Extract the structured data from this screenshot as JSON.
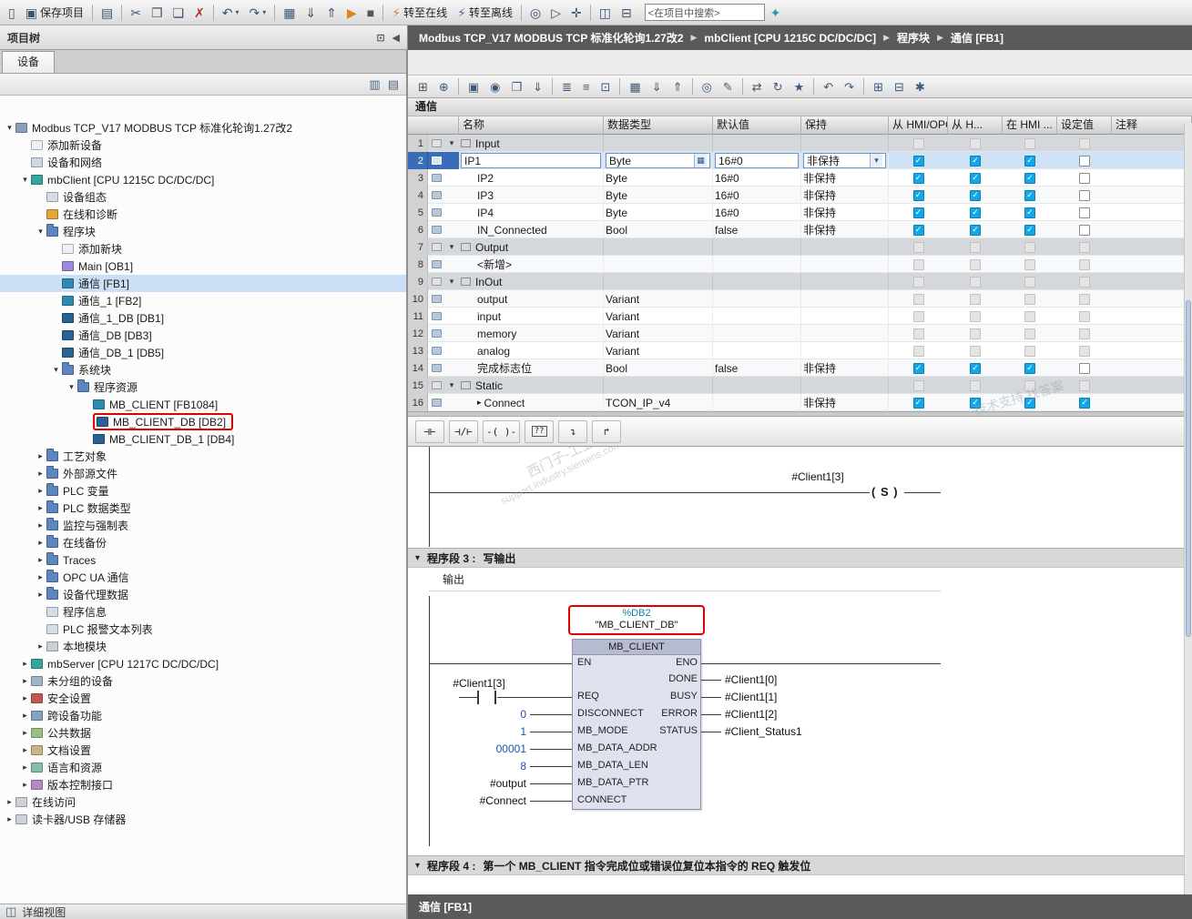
{
  "colors": {
    "check_on": "#14a7e8",
    "selection_blue": "#3a6db8",
    "highlight_red": "#e00000",
    "breadcrumb_bg": "#5a5a5a"
  },
  "breadcrumb": {
    "items": [
      "Modbus TCP_V17 MODBUS TCP 标准化轮询1.27改2",
      "mbClient [CPU 1215C DC/DC/DC]",
      "程序块",
      "通信 [FB1]"
    ]
  },
  "top_toolbar": {
    "items": [
      {
        "name": "new-project",
        "glyph": "▯"
      },
      {
        "name": "save-project",
        "glyph": "▣",
        "label": "保存项目"
      },
      {
        "sep": true
      },
      {
        "name": "print",
        "glyph": "▤"
      },
      {
        "sep": true
      },
      {
        "name": "cut",
        "glyph": "✂"
      },
      {
        "name": "copy",
        "glyph": "❐"
      },
      {
        "name": "paste",
        "glyph": "❏"
      },
      {
        "name": "delete",
        "glyph": "✗"
      },
      {
        "sep": true
      },
      {
        "name": "undo",
        "glyph": "↶",
        "dd": true
      },
      {
        "name": "redo",
        "glyph": "↷",
        "dd": true
      },
      {
        "sep": true
      },
      {
        "name": "compile",
        "glyph": "▦"
      },
      {
        "name": "download-to-device",
        "glyph": "⇓"
      },
      {
        "name": "upload-from-device",
        "glyph": "⇑"
      },
      {
        "name": "start-cpu",
        "glyph": "▶"
      },
      {
        "name": "stop-cpu",
        "glyph": "■"
      },
      {
        "sep": true
      },
      {
        "name": "go-online",
        "glyph": "⚡",
        "label": "转至在线"
      },
      {
        "name": "go-offline",
        "glyph": "⚡",
        "label": "转至离线"
      },
      {
        "sep": true
      },
      {
        "name": "accessible-devices",
        "glyph": "◎"
      },
      {
        "name": "start-simulation",
        "glyph": "▷"
      },
      {
        "name": "cross-reference",
        "glyph": "✛"
      },
      {
        "sep": true
      },
      {
        "name": "split-editor-horizontal",
        "glyph": "◫"
      },
      {
        "name": "split-editor-vertical",
        "glyph": "⊟"
      },
      {
        "search": true,
        "name": "project-search",
        "value": "<在项目中搜索>"
      },
      {
        "name": "tia-portal",
        "glyph": "✦"
      }
    ]
  },
  "sidebar": {
    "title": "项目树",
    "tab_devices": "设备",
    "detail_view": "详细视图",
    "tree": [
      {
        "indent": 0,
        "exp": "v",
        "icon": "project",
        "label": "Modbus TCP_V17 MODBUS TCP 标准化轮询1.27改2"
      },
      {
        "indent": 1,
        "icon": "add-device",
        "label": "添加新设备"
      },
      {
        "indent": 1,
        "icon": "devices-networks",
        "label": "设备和网络"
      },
      {
        "indent": 1,
        "exp": "v",
        "icon": "plc",
        "label": "mbClient [CPU 1215C DC/DC/DC]"
      },
      {
        "indent": 2,
        "icon": "device-config",
        "label": "设备组态"
      },
      {
        "indent": 2,
        "icon": "online-diagnostics",
        "label": "在线和诊断"
      },
      {
        "indent": 2,
        "exp": "v",
        "icon": "folder-program",
        "label": "程序块"
      },
      {
        "indent": 3,
        "icon": "add-block",
        "label": "添加新块"
      },
      {
        "indent": 3,
        "icon": "block-ob",
        "label": "Main [OB1]"
      },
      {
        "indent": 3,
        "icon": "block-fb",
        "label": "通信 [FB1]",
        "sel": true
      },
      {
        "indent": 3,
        "icon": "block-fb",
        "label": "通信_1 [FB2]"
      },
      {
        "indent": 3,
        "icon": "block-db",
        "label": "通信_1_DB [DB1]"
      },
      {
        "indent": 3,
        "icon": "block-db",
        "label": "通信_DB [DB3]"
      },
      {
        "indent": 3,
        "icon": "block-db",
        "label": "通信_DB_1 [DB5]"
      },
      {
        "indent": 3,
        "exp": "v",
        "icon": "folder-system",
        "label": "系统块"
      },
      {
        "indent": 4,
        "exp": "v",
        "icon": "folder-resources",
        "label": "程序资源"
      },
      {
        "indent": 5,
        "icon": "block-fb",
        "label": "MB_CLIENT [FB1084]"
      },
      {
        "indent": 5,
        "icon": "block-db",
        "label": "MB_CLIENT_DB [DB2]",
        "red": true
      },
      {
        "indent": 5,
        "icon": "block-db",
        "label": "MB_CLIENT_DB_1 [DB4]"
      },
      {
        "indent": 2,
        "exp": ">",
        "icon": "folder-tech",
        "label": "工艺对象"
      },
      {
        "indent": 2,
        "exp": ">",
        "icon": "folder-sources",
        "label": "外部源文件"
      },
      {
        "indent": 2,
        "exp": ">",
        "icon": "folder-tags",
        "label": "PLC 变量"
      },
      {
        "indent": 2,
        "exp": ">",
        "icon": "folder-datatypes",
        "label": "PLC 数据类型"
      },
      {
        "indent": 2,
        "exp": ">",
        "icon": "folder-watch",
        "label": "监控与强制表"
      },
      {
        "indent": 2,
        "exp": ">",
        "icon": "folder-backup",
        "label": "在线备份"
      },
      {
        "indent": 2,
        "exp": ">",
        "icon": "folder-traces",
        "label": "Traces"
      },
      {
        "indent": 2,
        "exp": ">",
        "icon": "folder-opcua",
        "label": "OPC UA 通信"
      },
      {
        "indent": 2,
        "exp": ">",
        "icon": "folder-proxy",
        "label": "设备代理数据"
      },
      {
        "indent": 2,
        "icon": "program-info",
        "label": "程序信息"
      },
      {
        "indent": 2,
        "icon": "alarm-texts",
        "label": "PLC 报警文本列表"
      },
      {
        "indent": 2,
        "exp": ">",
        "icon": "local-modules",
        "label": "本地模块"
      },
      {
        "indent": 1,
        "exp": ">",
        "icon": "plc",
        "label": "mbServer [CPU 1217C DC/DC/DC]"
      },
      {
        "indent": 1,
        "exp": ">",
        "icon": "ungrouped-devices",
        "label": "未分组的设备"
      },
      {
        "indent": 1,
        "exp": ">",
        "icon": "security-settings",
        "label": "安全设置"
      },
      {
        "indent": 1,
        "exp": ">",
        "icon": "cross-device",
        "label": "跨设备功能"
      },
      {
        "indent": 1,
        "exp": ">",
        "icon": "common-data",
        "label": "公共数据"
      },
      {
        "indent": 1,
        "exp": ">",
        "icon": "doc-settings",
        "label": "文档设置"
      },
      {
        "indent": 1,
        "exp": ">",
        "icon": "languages",
        "label": "语言和资源"
      },
      {
        "indent": 1,
        "exp": ">",
        "icon": "version-control",
        "label": "版本控制接口"
      },
      {
        "indent": 0,
        "exp": ">",
        "icon": "online-access",
        "label": "在线访问"
      },
      {
        "indent": 0,
        "exp": ">",
        "icon": "card-reader",
        "label": "读卡器/USB 存储器"
      }
    ]
  },
  "editor": {
    "block_title": "通信",
    "bottom_tab": "通信 [FB1]",
    "toolbar": {
      "items": [
        {
          "name": "insert-row",
          "glyph": "⊞"
        },
        {
          "name": "add-row",
          "glyph": "⊕"
        },
        {
          "sep": true
        },
        {
          "name": "keep-actual-values",
          "glyph": "▣"
        },
        {
          "name": "snapshot-actual-values",
          "glyph": "◉"
        },
        {
          "name": "copy-snapshot-to-start",
          "glyph": "❐"
        },
        {
          "name": "load-start-values",
          "glyph": "⇓"
        },
        {
          "sep": true
        },
        {
          "name": "sort-ascending",
          "glyph": "≣"
        },
        {
          "name": "sort-descending",
          "glyph": "≡"
        },
        {
          "name": "toggle-comment",
          "glyph": "⊡"
        },
        {
          "sep": true
        },
        {
          "name": "compile-block",
          "glyph": "▦"
        },
        {
          "name": "download-block",
          "glyph": "⇓"
        },
        {
          "name": "upload-block",
          "glyph": "⇑"
        },
        {
          "sep": true
        },
        {
          "name": "monitor-on-off",
          "glyph": "◎"
        },
        {
          "name": "modify-values",
          "glyph": "✎"
        },
        {
          "sep": true
        },
        {
          "name": "absolute-operands",
          "glyph": "⇄"
        },
        {
          "name": "update-block-call",
          "glyph": "↻"
        },
        {
          "name": "show-favorites",
          "glyph": "★"
        },
        {
          "sep": true
        },
        {
          "name": "go-to-previous",
          "glyph": "↶"
        },
        {
          "name": "go-to-next",
          "glyph": "↷"
        },
        {
          "sep": true
        },
        {
          "name": "insert-network",
          "glyph": "⊞"
        },
        {
          "name": "delete-network",
          "glyph": "⊟"
        },
        {
          "name": "settings",
          "glyph": "✱"
        }
      ]
    },
    "table": {
      "columns": [
        "",
        "名称",
        "数据类型",
        "默认值",
        "保持",
        "从 HMI/OPC..",
        "从 H...",
        "在 HMI ...",
        "设定值",
        "注释"
      ],
      "rows": [
        {
          "n": 1,
          "kind": "section",
          "name": "Input",
          "type": "",
          "def": "",
          "retain": ""
        },
        {
          "n": 2,
          "kind": "var",
          "name": "IP1",
          "type": "Byte",
          "def": "16#0",
          "retain": "非保持",
          "c": [
            1,
            1,
            1,
            0
          ],
          "selected": true
        },
        {
          "n": 3,
          "kind": "var",
          "name": "IP2",
          "type": "Byte",
          "def": "16#0",
          "retain": "非保持",
          "c": [
            1,
            1,
            1,
            0
          ]
        },
        {
          "n": 4,
          "kind": "var",
          "name": "IP3",
          "type": "Byte",
          "def": "16#0",
          "retain": "非保持",
          "c": [
            1,
            1,
            1,
            0
          ]
        },
        {
          "n": 5,
          "kind": "var",
          "name": "IP4",
          "type": "Byte",
          "def": "16#0",
          "retain": "非保持",
          "c": [
            1,
            1,
            1,
            0
          ]
        },
        {
          "n": 6,
          "kind": "var",
          "name": "IN_Connected",
          "type": "Bool",
          "def": "false",
          "retain": "非保持",
          "c": [
            1,
            1,
            1,
            0
          ]
        },
        {
          "n": 7,
          "kind": "section",
          "name": "Output",
          "type": "",
          "def": "",
          "retain": ""
        },
        {
          "n": 8,
          "kind": "add",
          "name": "<新增>",
          "type": "",
          "def": "",
          "retain": ""
        },
        {
          "n": 9,
          "kind": "section",
          "name": "InOut",
          "type": "",
          "def": "",
          "retain": ""
        },
        {
          "n": 10,
          "kind": "var",
          "name": "output",
          "type": "Variant",
          "def": "",
          "retain": "",
          "c": [
            -1,
            -1,
            -1,
            -1
          ]
        },
        {
          "n": 11,
          "kind": "var",
          "name": "input",
          "type": "Variant",
          "def": "",
          "retain": "",
          "c": [
            -1,
            -1,
            -1,
            -1
          ]
        },
        {
          "n": 12,
          "kind": "var",
          "name": "memory",
          "type": "Variant",
          "def": "",
          "retain": "",
          "c": [
            -1,
            -1,
            -1,
            -1
          ]
        },
        {
          "n": 13,
          "kind": "var",
          "name": "analog",
          "type": "Variant",
          "def": "",
          "retain": "",
          "c": [
            -1,
            -1,
            -1,
            -1
          ]
        },
        {
          "n": 14,
          "kind": "var",
          "name": "完成标志位",
          "type": "Bool",
          "def": "false",
          "retain": "非保持",
          "c": [
            1,
            1,
            1,
            0
          ]
        },
        {
          "n": 15,
          "kind": "section",
          "name": "Static",
          "type": "",
          "def": "",
          "retain": ""
        },
        {
          "n": 16,
          "kind": "var",
          "name": "Connect",
          "type": "TCON_IP_v4",
          "def": "",
          "retain": "非保持",
          "c": [
            1,
            1,
            1,
            1
          ],
          "exp": ">"
        }
      ]
    },
    "ladder": {
      "toolbar": [
        {
          "name": "no-contact",
          "glyph": "⊣⊢"
        },
        {
          "name": "nc-contact",
          "glyph": "⊣/⊢"
        },
        {
          "name": "coil",
          "glyph": "-( )-"
        },
        {
          "name": "empty-box",
          "glyph": "??"
        },
        {
          "name": "open-branch",
          "glyph": "↴"
        },
        {
          "name": "close-branch",
          "glyph": "↱"
        }
      ],
      "network2": {
        "operand": "#Client1[3]",
        "coil_text": "( S )"
      },
      "network3": {
        "header_label": "程序段 3 :",
        "header_title": "写输出",
        "comment": "输出",
        "db_line1": "%DB2",
        "db_line2": "\"MB_CLIENT_DB\"",
        "block_title": "MB_CLIENT",
        "en": "EN",
        "eno": "ENO",
        "left_pins": [
          {
            "pin": "REQ",
            "operand": "#Client1[3]",
            "contact": true
          },
          {
            "pin": "DISCONNECT",
            "operand": "0"
          },
          {
            "pin": "MB_MODE",
            "operand": "1"
          },
          {
            "pin": "MB_DATA_ADDR",
            "operand": "00001"
          },
          {
            "pin": "MB_DATA_LEN",
            "operand": "8"
          },
          {
            "pin": "MB_DATA_PTR",
            "operand": "#output"
          },
          {
            "pin": "CONNECT",
            "operand": "#Connect"
          }
        ],
        "right_pins": [
          {
            "pin": "DONE",
            "operand": "#Client1[0]"
          },
          {
            "pin": "BUSY",
            "operand": "#Client1[1]"
          },
          {
            "pin": "ERROR",
            "operand": "#Client1[2]"
          },
          {
            "pin": "STATUS",
            "operand": "#Client_Status1"
          }
        ]
      },
      "network4": {
        "header_label": "程序段 4 :",
        "header_title": "第一个 MB_CLIENT 指令完成位或错误位复位本指令的 REQ 触发位"
      },
      "watermark": {
        "wm1a": "西门子-工业",
        "wm1b": "support.industry.siemens.com/cs",
        "wm2": "技术支持  找答案"
      }
    }
  }
}
